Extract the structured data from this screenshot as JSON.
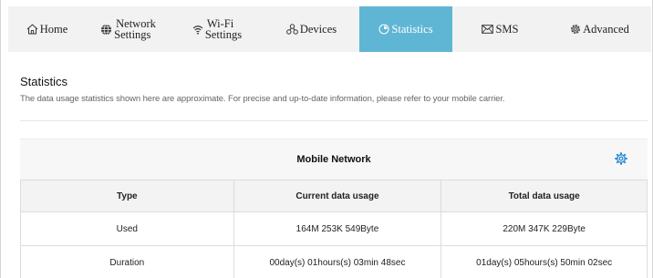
{
  "nav": {
    "home": "Home",
    "network_line1": "Network",
    "network_line2": "Settings",
    "wifi_line1": "Wi-Fi",
    "wifi_line2": "Settings",
    "devices": "Devices",
    "statistics": "Statistics",
    "sms": "SMS",
    "advanced": "Advanced",
    "active": "statistics",
    "active_color": "#5fb6d4"
  },
  "page": {
    "title": "Statistics",
    "description": "The data usage statistics shown here are approximate. For precise and up-to-date information, please refer to your mobile carrier."
  },
  "panel": {
    "title": "Mobile Network",
    "settings_icon": "gear-icon",
    "accent_color": "#2f8fd8"
  },
  "table": {
    "headers": [
      "Type",
      "Current data usage",
      "Total data usage"
    ],
    "rows": [
      [
        "Used",
        "164M 253K 549Byte",
        "220M 347K 229Byte"
      ],
      [
        "Duration",
        "00day(s) 01hours(s) 03min 48sec",
        "01day(s) 05hours(s) 50min 02sec"
      ]
    ]
  }
}
